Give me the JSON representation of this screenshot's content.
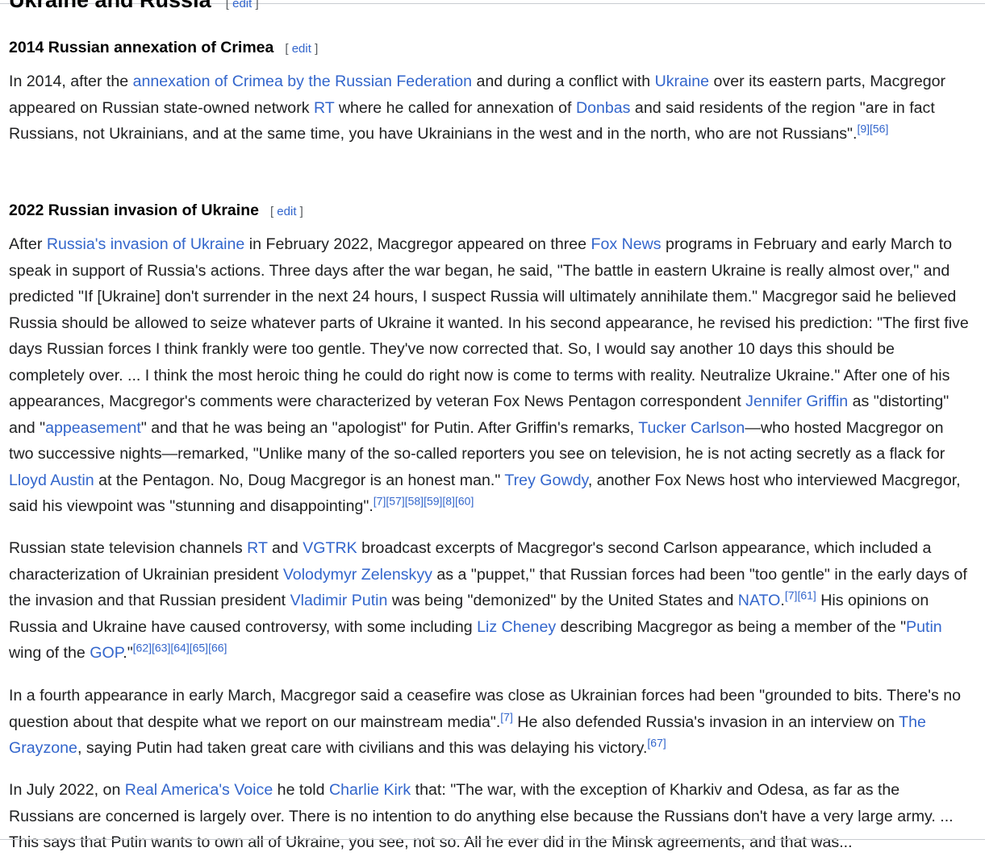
{
  "section": {
    "title": "Ukraine and Russia",
    "edit": "edit"
  },
  "sub1": {
    "title": "2014 Russian annexation of Crimea",
    "edit": "edit"
  },
  "p1": {
    "t1": "In 2014, after the ",
    "l1": "annexation of Crimea by the Russian Federation",
    "t2": " and during a conflict with ",
    "l2": "Ukraine",
    "t3": " over its eastern parts, Macgregor appeared on Russian state-owned network ",
    "l3": "RT",
    "t4": " where he called for annexation of ",
    "l4": "Donbas",
    "t5": " and said residents of the region \"are in fact Russians, not Ukrainians, and at the same time, you have Ukrainians in the west and in the north, who are not Russians\".",
    "cite": "[9][56]"
  },
  "sub2": {
    "title": "2022 Russian invasion of Ukraine",
    "edit": "edit"
  },
  "p2": {
    "t1": "After ",
    "l1": "Russia's invasion of Ukraine",
    "t2": " in February 2022, Macgregor appeared on three ",
    "l2": "Fox News",
    "t3": " programs in February and early March to speak in support of Russia's actions. Three days after the war began, he said, \"The battle in eastern Ukraine is really almost over,\" and predicted \"If [Ukraine] don't surrender in the next 24 hours, I suspect Russia will ultimately annihilate them.\" Macgregor said he believed Russia should be allowed to seize whatever parts of Ukraine it wanted. In his second appearance, he revised his prediction: \"The first five days Russian forces I think frankly were too gentle. They've now corrected that. So, I would say another 10 days this should be completely over. ... I think the most heroic thing he could do right now is come to terms with reality. Neutralize Ukraine.\" After one of his appearances, Macgregor's comments were characterized by veteran Fox News Pentagon correspondent ",
    "l3": "Jennifer Griffin",
    "t4": " as \"distorting\" and \"",
    "l4": "appeasement",
    "t5": "\" and that he was being an \"apologist\" for Putin. After Griffin's remarks, ",
    "l5": "Tucker Carlson",
    "t6": "—who hosted Macgregor on two successive nights—remarked, \"Unlike many of the so-called reporters you see on television, he is not acting secretly as a flack for ",
    "l6": "Lloyd Austin",
    "t7": " at the Pentagon. No, Doug Macgregor is an honest man.\" ",
    "l7": "Trey Gowdy",
    "t8": ", another Fox News host who interviewed Macgregor, said his viewpoint was \"stunning and disappointing\".",
    "cite": "[7][57][58][59][8][60]"
  },
  "p3": {
    "t1": "Russian state television channels ",
    "l1": "RT",
    "t2": " and ",
    "l2": "VGTRK",
    "t3": " broadcast excerpts of Macgregor's second Carlson appearance, which included a characterization of Ukrainian president ",
    "l3": "Volodymyr Zelenskyy",
    "t4": " as a \"puppet,\" that Russian forces had been \"too gentle\" in the early days of the invasion and that Russian president ",
    "l4": "Vladimir Putin",
    "t5": " was being \"demonized\" by the United States and ",
    "l5": "NATO",
    "t6": ".",
    "cite1": "[7][61]",
    "t7": " His opinions on Russia and Ukraine have caused controversy, with some including ",
    "l6": "Liz Cheney",
    "t8": " describing Macgregor as being a member of the \"",
    "l7": "Putin",
    "t9": " wing of the ",
    "l8": "GOP",
    "t10": ".\"",
    "cite2": "[62][63][64][65][66]"
  },
  "p4": {
    "t1": "In a fourth appearance in early March, Macgregor said a ceasefire was close as Ukrainian forces had been \"grounded to bits. There's no question about that despite what we report on our mainstream media\".",
    "cite1": "[7]",
    "t2": " He also defended Russia's invasion in an interview on ",
    "l1": "The Grayzone",
    "t3": ", saying Putin had taken great care with civilians and this was delaying his victory.",
    "cite2": "[67]"
  },
  "p5": {
    "t1": "In July 2022, on ",
    "l1": "Real America's Voice",
    "t2": " he told ",
    "l2": "Charlie Kirk",
    "t3": " that: \"The war, with the exception of Kharkiv and Odesa, as far as the Russians are concerned is largely over. There is no intention to do anything else because the Russians don't have a very large army. ... This says that Putin wants to own all of Ukraine, you see, not so. All he ever did in the Minsk agreements, and that was..."
  }
}
